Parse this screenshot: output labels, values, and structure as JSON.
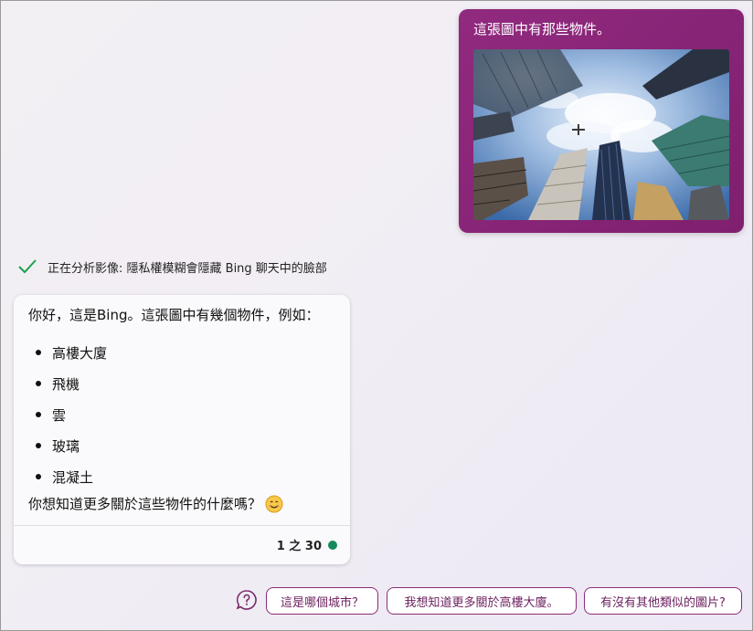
{
  "user_message": {
    "text": "這張圖中有那些物件。",
    "image_alt": "skyscrapers-looking-up-with-airplane"
  },
  "status": {
    "icon": "check-icon",
    "text": "正在分析影像: 隱私權模糊會隱藏 Bing 聊天中的臉部"
  },
  "bot_response": {
    "intro": "你好，這是Bing。這張圖中有幾個物件，例如：",
    "items": [
      "高樓大廈",
      "飛機",
      "雲",
      "玻璃",
      "混凝土"
    ],
    "outro": "你想知道更多關於這些物件的什麼嗎？",
    "counter": "1 之 30",
    "counter_dot_color": "#138a5b"
  },
  "suggestions": {
    "help_icon": "question-bubble-icon",
    "items": [
      "這是哪個城市？",
      "我想知道更多關於高樓大廈。",
      "有沒有其他類似的圖片?"
    ]
  },
  "colors": {
    "user_bubble": "#8a2478",
    "accent": "#8c2c7a",
    "success": "#1aa34a"
  }
}
